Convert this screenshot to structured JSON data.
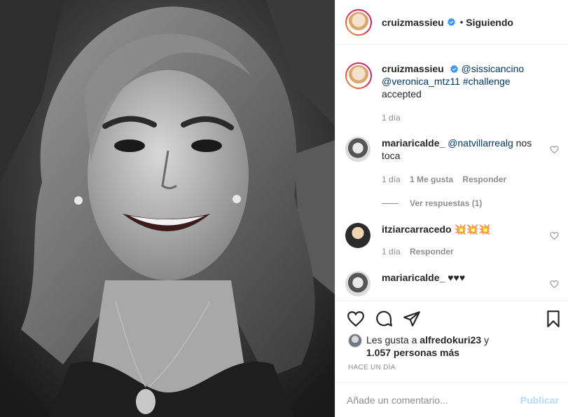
{
  "header": {
    "username": "cruizmassieu",
    "dot": "•",
    "follow_status": "Siguiendo"
  },
  "caption": {
    "username": "cruizmassieu",
    "mention1": "@sissicancino",
    "mention2": "@veronica_mtz11",
    "hashtag": "#challenge",
    "text": "accepted",
    "time": "1 día"
  },
  "comments": [
    {
      "username": "mariaricalde_",
      "mention": "@natvillarrealg",
      "text": "nos toca",
      "time": "1 día",
      "likes": "1 Me gusta",
      "reply": "Responder",
      "view_replies": "Ver respuestas (1)"
    },
    {
      "username": "itziarcarracedo",
      "text": "💥💥💥",
      "time": "1 día",
      "reply": "Responder"
    },
    {
      "username": "mariaricalde_",
      "text": "♥♥♥"
    }
  ],
  "likes": {
    "prefix": "Les gusta a",
    "user": "alfredokuri23",
    "joiner": "y",
    "count": "1.057 personas más"
  },
  "time_ago": "HACE UN DÍA",
  "add_comment": {
    "placeholder": "Añade un comentario...",
    "publish_label": "Publicar"
  },
  "icons": {
    "like": "heart-icon",
    "comment": "comment-icon",
    "share": "share-icon",
    "save": "bookmark-icon",
    "verified": "verified-badge-icon"
  },
  "colors": {
    "text": "#262626",
    "muted": "#8e8e8e",
    "link": "#00376b",
    "verified": "#3897f0",
    "publish": "#b3dbff"
  }
}
